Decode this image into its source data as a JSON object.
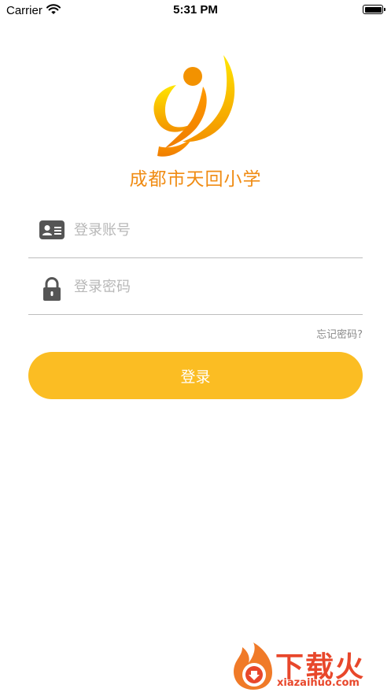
{
  "status_bar": {
    "carrier": "Carrier",
    "time": "5:31 PM"
  },
  "school": {
    "name": "成都市天回小学"
  },
  "form": {
    "account_placeholder": "登录账号",
    "account_value": "",
    "password_placeholder": "登录密码",
    "password_value": "",
    "forgot_label": "忘记密码?",
    "login_label": "登录"
  },
  "watermark": {
    "text": "下载火",
    "url": "xiazaihuo.com"
  },
  "colors": {
    "accent": "#fbbd23",
    "logo_orange": "#f08c14",
    "logo_yellow": "#ffd400",
    "watermark_red": "#e8472b",
    "icon_gray": "#555555"
  },
  "icons": {
    "wifi": "wifi-icon",
    "battery": "battery-icon",
    "account": "id-card-icon",
    "password": "lock-icon"
  }
}
